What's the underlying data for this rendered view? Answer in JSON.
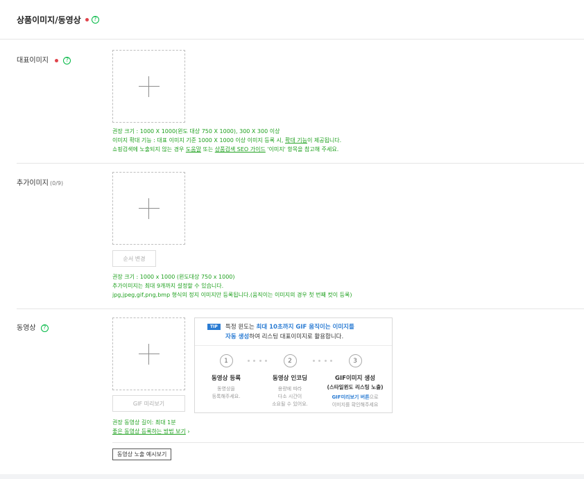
{
  "header": {
    "title": "상품이미지/동영상",
    "help": "?"
  },
  "main_image": {
    "label": "대표이미지",
    "help": "?",
    "guide": {
      "line1": "권장 크기 : 1000 X 1000(윈도 대상 750 X 1000), 300 X 300 이상",
      "line2_pre": "이미지 확대 기능 : 대표 이미지 기준 1000 X 1000 이상 이미지 등록 시, ",
      "line2_link": "확대 기능",
      "line2_post": "이 제공됩니다.",
      "line3_pre": "쇼핑검색에 노출되지 않는 경우 ",
      "line3_link1": "도움말",
      "line3_mid": " 또는 ",
      "line3_link2": "상품검색 SEO 가이드",
      "line3_post": " '이미지' 항목을 참고해 주세요."
    }
  },
  "extra_image": {
    "label": "추가이미지",
    "count": "(0/9)",
    "reorder_label": "순서 변경",
    "guide": {
      "line1": "권장 크기 : 1000 x 1000 (윈도대상 750 x 1000)",
      "line2": "추가이미지는 최대 9개까지 설정할 수 있습니다.",
      "line3": "jpg,jpeg,gif,png,bmp 형식의 정지 이미지만 등록됩니다.(움직이는 이미지의 경우 첫 번째 컷이 등록)"
    }
  },
  "video": {
    "label": "동영상",
    "help": "?",
    "gif_preview_label": "GIF 미리보기",
    "guide": {
      "line1": "권장 동영상 길이: 최대 1분",
      "line2": "좋은 동영상 등록하는 방법 보기",
      "arrow": "›"
    },
    "preview_button": "동영상 노출 예시보기",
    "tip": {
      "badge": "TIP",
      "line1_pre": "특정 윈도는 ",
      "line1_hl": "최대 10초까지 GIF 움직이는 이미지를",
      "line2_hl": "자동 생성",
      "line2_post": "하여 리스팅 대표이미지로 활용합니다.",
      "steps": [
        {
          "num": "1",
          "title": "동영상 등록",
          "sub": "",
          "desc1": "동영상을",
          "desc2": "등록해주세요.",
          "desc_hl": ""
        },
        {
          "num": "2",
          "title": "동영상 인코딩",
          "sub": "",
          "desc1": "용량에 따라",
          "desc2": "다소 시간이",
          "desc3": "소요될 수 있어요."
        },
        {
          "num": "3",
          "title": "GIF이미지 생성",
          "sub": "(스타일윈도 리스팅 노출)",
          "desc_hl": "GIF미리보기 버튼",
          "desc1_post": "으로",
          "desc2": "이미지를 확인해주세요"
        }
      ]
    }
  }
}
